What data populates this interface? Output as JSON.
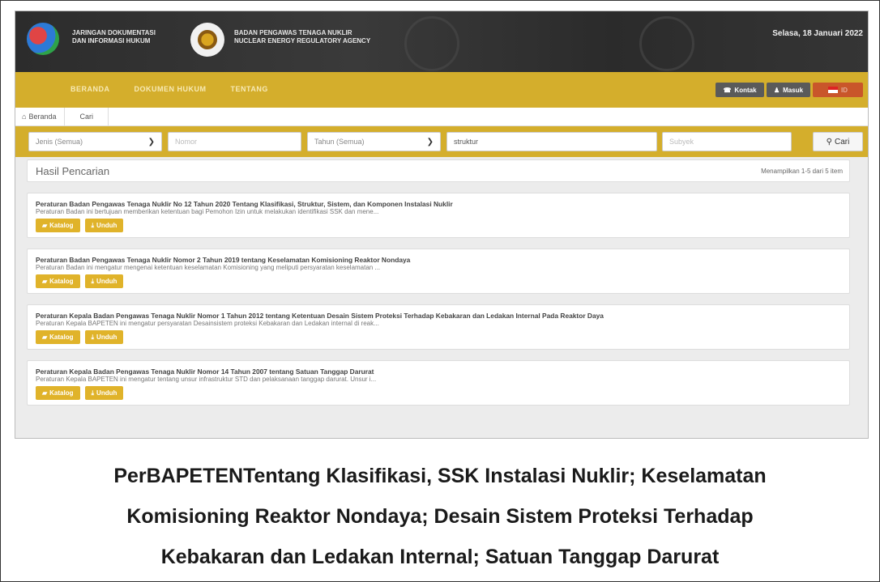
{
  "header": {
    "jdih_text": [
      "JARINGAN DOKUMENTASI",
      "DAN INFORMASI HUKUM"
    ],
    "agency_text": [
      "BADAN PENGAWAS TENAGA NUKLIR",
      "NUCLEAR ENERGY REGULATORY AGENCY"
    ],
    "date": "Selasa, 18 Januari 2022"
  },
  "nav": {
    "items": [
      "BERANDA",
      "DOKUMEN HUKUM",
      "TENTANG"
    ],
    "kontak": "Kontak",
    "masuk": "Masuk",
    "lang": "ID"
  },
  "breadcrumb": [
    "Beranda",
    "Cari"
  ],
  "search": {
    "jenis": "Jenis (Semua)",
    "nomor_placeholder": "Nomor",
    "tahun": "Tahun (Semua)",
    "keyword": "struktur",
    "subyek_placeholder": "Subyek",
    "cari": "Cari"
  },
  "results": {
    "heading": "Hasil Pencarian",
    "count": "Menampilkan 1-5 dari 5 item",
    "katalog_label": "Katalog",
    "unduh_label": "Unduh",
    "items": [
      {
        "title": "Peraturan Badan Pengawas Tenaga Nuklir No 12 Tahun 2020 Tentang Klasifikasi, Struktur, Sistem, dan Komponen Instalasi Nuklir",
        "desc": "Peraturan Badan ini bertujuan memberikan ketentuan bagi Pemohon Izin untuk melakukan identifikasi SSK dan mene..."
      },
      {
        "title": "Peraturan Badan Pengawas Tenaga Nuklir Nomor 2 Tahun 2019 tentang Keselamatan Komisioning Reaktor Nondaya",
        "desc": "Peraturan Badan ini mengatur mengenai ketentuan keselamatan Komisioning yang meliputi persyaratan keselamatan ..."
      },
      {
        "title": "Peraturan Kepala Badan Pengawas Tenaga Nuklir Nomor 1 Tahun 2012 tentang Ketentuan Desain Sistem Proteksi Terhadap Kebakaran dan Ledakan Internal Pada Reaktor Daya",
        "desc": "Peraturan Kepala BAPETEN ini mengatur persyaratan Desainsistem proteksi Kebakaran dan Ledakan internal di reak..."
      },
      {
        "title": "Peraturan Kepala Badan Pengawas Tenaga Nuklir Nomor 14 Tahun 2007 tentang Satuan Tanggap Darurat",
        "desc": "Peraturan Kepala BAPETEN ini mengatur tentang unsur infrastruktur STD dan pelaksanaan tanggap darurat. Unsur i..."
      }
    ]
  },
  "caption": [
    "PerBAPETENTentang Klasifikasi, SSK Instalasi Nuklir; Keselamatan",
    "Komisioning Reaktor Nondaya; Desain Sistem Proteksi Terhadap",
    "Kebakaran dan Ledakan Internal; Satuan Tanggap Darurat"
  ]
}
